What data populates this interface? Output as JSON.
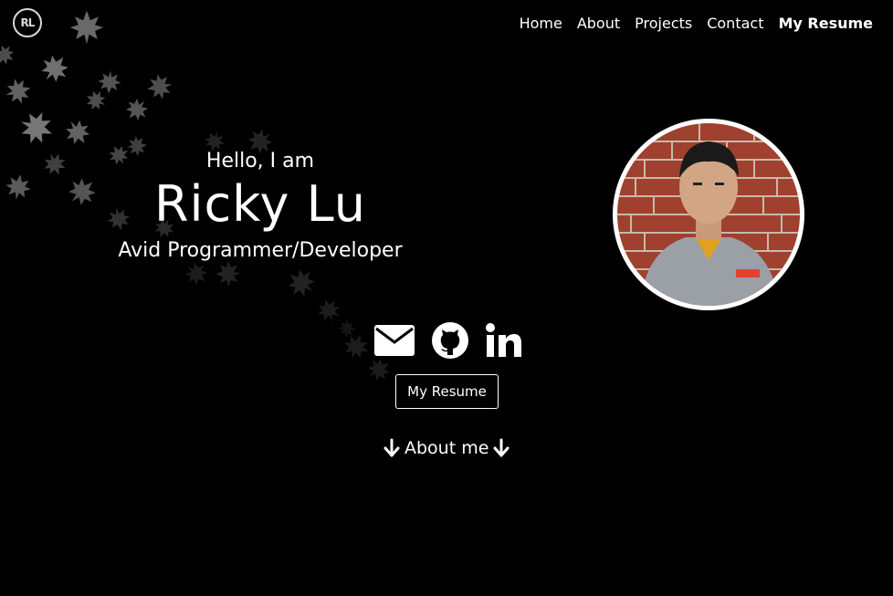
{
  "brand": {
    "logo_text": "RL"
  },
  "nav": {
    "items": [
      {
        "label": "Home"
      },
      {
        "label": "About"
      },
      {
        "label": "Projects"
      },
      {
        "label": "Contact"
      },
      {
        "label": "My Resume"
      }
    ]
  },
  "hero": {
    "greeting": "Hello, I am",
    "name": "Ricky Lu",
    "tagline": "Avid Programmer/Developer"
  },
  "socials": {
    "icons": [
      "envelope-icon",
      "github-icon",
      "linkedin-icon"
    ]
  },
  "resume_button": {
    "label": "My Resume"
  },
  "about_link": {
    "label": "About me"
  },
  "colors": {
    "background": "#000000",
    "text": "#ffffff",
    "leaf": "#8c8c8c",
    "avatar_border": "#ffffff"
  }
}
